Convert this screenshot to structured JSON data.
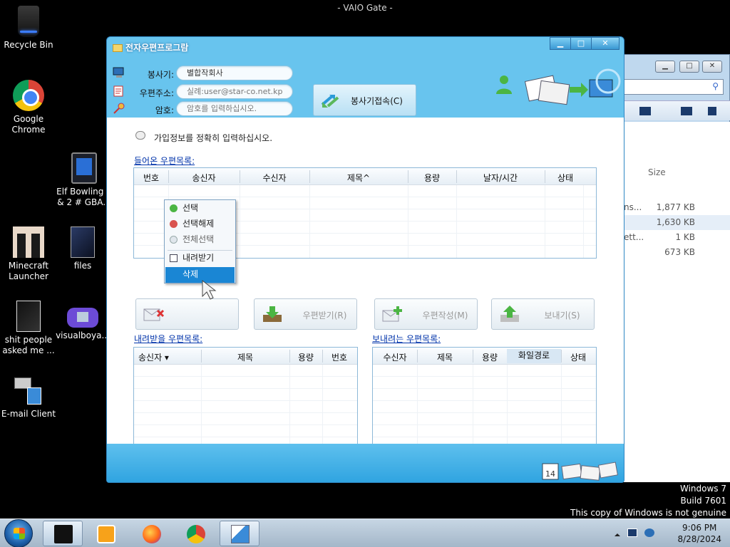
{
  "top_caption": "- VAIO Gate -",
  "desktop": {
    "icons": [
      {
        "label": "Recycle Bin"
      },
      {
        "label": "Google Chrome"
      },
      {
        "label": "Elf Bowling 1 & 2 # GBA..."
      },
      {
        "label": "Minecraft Launcher"
      },
      {
        "label": "files"
      },
      {
        "label": "shit people asked me ..."
      },
      {
        "label": "visualboya..."
      },
      {
        "label": "E-mail Client"
      }
    ]
  },
  "explorer": {
    "column_size": "Size",
    "rows": [
      {
        "name": "ns...",
        "size": "1,877 KB"
      },
      {
        "name": "",
        "size": "1,630 KB"
      },
      {
        "name": "ett...",
        "size": "1 KB"
      },
      {
        "name": "",
        "size": "673 KB"
      }
    ]
  },
  "app": {
    "title": "전자우편프로그람",
    "window_buttons": {
      "minimize": "▁",
      "maximize": "□",
      "close": "✕"
    },
    "server_label": "봉사기:",
    "server_value": "별합작회사",
    "address_label": "우편주소:",
    "address_placeholder": "실례:user@star-co.net.kp",
    "password_label": "암호:",
    "password_placeholder": "암호를 입력하십시오.",
    "connect_label": "봉사기접속(C)",
    "info_text": "가입정보를 정확히 입력하십시오.",
    "inbox": {
      "title": "들어온 우편목록:",
      "columns": [
        "번호",
        "송신자",
        "수신자",
        "제목^",
        "용량",
        "날자/시간",
        "상태"
      ]
    },
    "actions": {
      "delete": "",
      "receive": "우편받기(R)",
      "compose": "우편작성(M)",
      "send": "보내기(S)"
    },
    "download_list": {
      "title": "내려받을 우편목록:",
      "columns": [
        "송신자 ▾",
        "제목",
        "용량",
        "번호"
      ]
    },
    "send_list": {
      "title": "보내려는 우편목록:",
      "columns": [
        "수신자",
        "제목",
        "용량",
        "화일경로",
        "상태"
      ]
    },
    "context_menu": {
      "items": [
        {
          "label": "선택"
        },
        {
          "label": "선택해제"
        },
        {
          "label": "전체선택"
        },
        {
          "label": "내려받기"
        },
        {
          "label": "삭제"
        }
      ]
    }
  },
  "watermark": {
    "line1": "Windows 7",
    "line2": "Build 7601",
    "line3": "This copy of Windows is not genuine"
  },
  "taskbar": {
    "time": "9:06 PM",
    "date": "8/28/2024"
  }
}
